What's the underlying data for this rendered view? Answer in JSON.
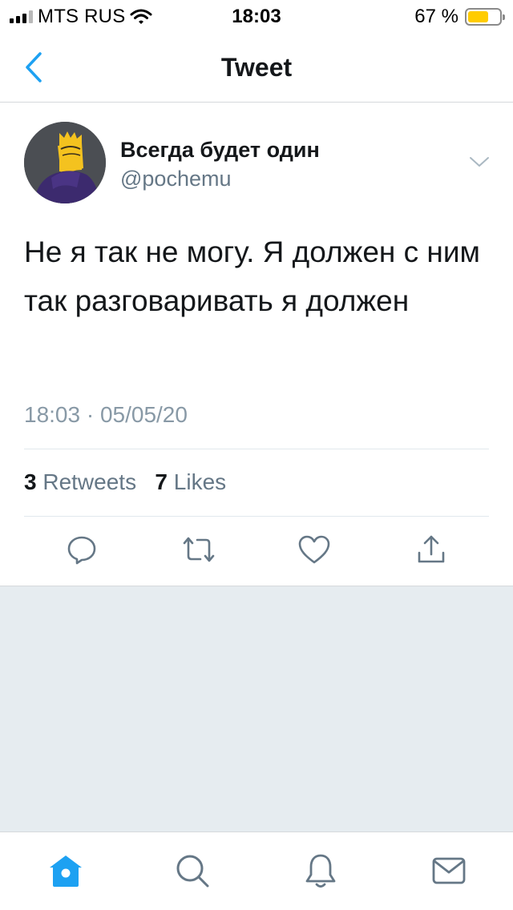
{
  "status_bar": {
    "carrier": "MTS RUS",
    "time": "18:03",
    "battery_percent_label": "67 %",
    "battery_level": 0.67,
    "battery_color": "#ffcc00",
    "icons": [
      "signal-icon",
      "wifi-icon",
      "battery-icon"
    ]
  },
  "nav": {
    "title": "Tweet",
    "back_icon": "chevron-left-icon",
    "accent": "#1da1f2"
  },
  "tweet": {
    "author_name": "Всегда будет один",
    "author_handle": "@pochemu",
    "text": "Не я так не могу. Я должен с ним так разговаривать я должен",
    "timestamp": "18:03 · 05/05/20",
    "retweets_count": "3",
    "retweets_label": "Retweets",
    "likes_count": "7",
    "likes_label": "Likes",
    "actions": [
      "reply-icon",
      "retweet-icon",
      "like-icon",
      "share-icon"
    ]
  },
  "tab_bar": {
    "items": [
      "home-icon",
      "search-icon",
      "notifications-icon",
      "messages-icon"
    ],
    "active": "home-icon"
  },
  "colors": {
    "text_primary": "#14171a",
    "text_secondary": "#657786",
    "empty_background": "#e6ecf0"
  }
}
